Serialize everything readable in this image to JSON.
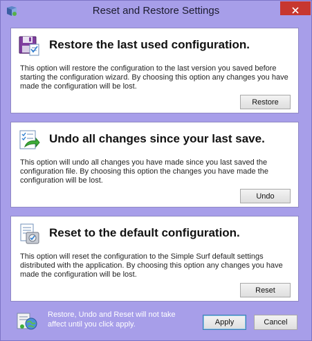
{
  "window": {
    "title": "Reset and Restore Settings",
    "accent_color": "#a79ee9",
    "close_color": "#c7372f"
  },
  "panels": [
    {
      "heading": "Restore the last used configuration.",
      "description": "This option will restore the configuration to the last version you saved before starting the configuration wizard.  By choosing this option any changes you have made the configuration will be lost.",
      "button_label": "Restore",
      "icon": "floppy-disk-checklist-icon"
    },
    {
      "heading": "Undo all changes since your last save.",
      "description": "This option will undo all changes you have made since you last saved the configuration file.  By choosing this option the changes you have made the configuration will be lost.",
      "button_label": "Undo",
      "icon": "undo-checklist-icon"
    },
    {
      "heading": "Reset to the default configuration.",
      "description": "This option will reset the configuration to the Simple Surf default settings distributed with the application.  By choosing this option any changes you have made the configuration will be lost.",
      "button_label": "Reset",
      "icon": "reset-defaults-icon"
    }
  ],
  "footer": {
    "note": "Restore, Undo and Reset will not take affect until you click apply.",
    "apply_label": "Apply",
    "cancel_label": "Cancel",
    "icon": "info-globe-icon"
  }
}
